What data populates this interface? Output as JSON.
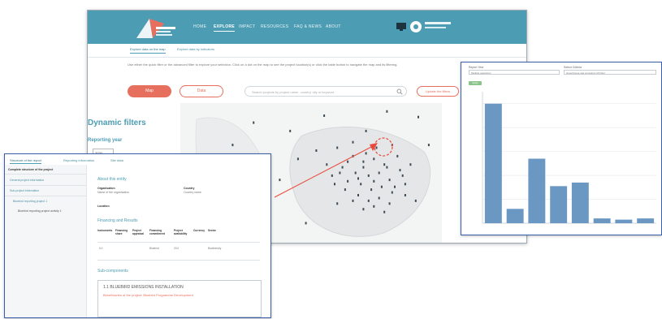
{
  "main_window": {
    "nav": [
      "HOME",
      "EXPLORE",
      "IMPACT",
      "RESOURCES",
      "FAQ & NEWS",
      "ABOUT"
    ],
    "active_nav_index": 1,
    "tabs": [
      "Explore data on the map",
      "Explore data by indicators"
    ],
    "active_tab_index": 0,
    "intro_text": "Use either the quick filter or the advanced filter to explore your selection. Click on a dot on the map to see the project location(s) or click the table button to navigate the map and its filtering.",
    "buttons": {
      "map": "Map",
      "data": "Data",
      "update": "Update the filters"
    },
    "search_placeholder": "Search projects by project name, country, city or keyword",
    "sidebar": {
      "title": "Dynamic filters",
      "reporting_year_label": "Reporting year",
      "reporting_year_value": "2020"
    }
  },
  "chart_window": {
    "filters": [
      {
        "label": "Report Year",
        "value": "Multiple selections"
      },
      {
        "label": "Select Criteria",
        "value": "Greenhouse gas emissions (tCO2e)"
      }
    ],
    "chip_label": "Apply",
    "colors": {
      "bar": "#6b97c3",
      "grid": "#e6e9ec"
    },
    "chart_data": {
      "type": "bar",
      "categories": [
        "",
        "",
        "",
        "",
        "",
        "",
        "",
        ""
      ],
      "values": [
        100,
        12,
        54,
        31,
        34,
        4,
        3,
        4
      ],
      "ylim": [
        0,
        110
      ],
      "ylabel": "",
      "grid": true
    }
  },
  "detail_window": {
    "tabs": [
      "Structure of the report",
      "Reporting information",
      "Site data"
    ],
    "tree": {
      "header": "Complete structure of the project",
      "items": [
        "General project information",
        "Sub-project information",
        "Bluebird reporting project 1",
        "Bluebird reporting project activity 1"
      ]
    },
    "sections": {
      "about": "About this entity",
      "financing": "Financing and Results",
      "sub": "Sub-components"
    },
    "about_fields": [
      {
        "label": "Organisation",
        "value": "Name of the organisation"
      },
      {
        "label": "Country",
        "value": "Country name"
      },
      {
        "label": "Location",
        "value": "Location"
      }
    ],
    "fin_headers": [
      "Instruments",
      "Financing share",
      "Project appraisal",
      "Financing commitment",
      "Project availability",
      "Currency",
      "Sector"
    ],
    "fin_values": [
      "5.0",
      "",
      "",
      "Bluebird",
      "20.0",
      "",
      "Biodiversity"
    ],
    "project": {
      "title": "1.1 BLUEBIRD EMISSIONS INSTALLATION",
      "subtitle": "Beneficiaries of the project: Bluebird Programme Development"
    }
  },
  "map_dots": [
    [
      0.28,
      0.14
    ],
    [
      0.55,
      0.09
    ],
    [
      0.79,
      0.06
    ],
    [
      0.91,
      0.1
    ],
    [
      0.71,
      0.2
    ],
    [
      0.6,
      0.32
    ],
    [
      0.66,
      0.38
    ],
    [
      0.7,
      0.42
    ],
    [
      0.74,
      0.4
    ],
    [
      0.78,
      0.44
    ],
    [
      0.62,
      0.46
    ],
    [
      0.67,
      0.5
    ],
    [
      0.72,
      0.52
    ],
    [
      0.76,
      0.5
    ],
    [
      0.8,
      0.55
    ],
    [
      0.84,
      0.48
    ],
    [
      0.64,
      0.56
    ],
    [
      0.69,
      0.58
    ],
    [
      0.73,
      0.62
    ],
    [
      0.77,
      0.6
    ],
    [
      0.81,
      0.64
    ],
    [
      0.86,
      0.58
    ],
    [
      0.68,
      0.66
    ],
    [
      0.72,
      0.7
    ],
    [
      0.76,
      0.68
    ],
    [
      0.8,
      0.72
    ],
    [
      0.63,
      0.62
    ],
    [
      0.58,
      0.52
    ],
    [
      0.56,
      0.44
    ],
    [
      0.83,
      0.38
    ],
    [
      0.88,
      0.44
    ],
    [
      0.75,
      0.32
    ],
    [
      0.81,
      0.3
    ],
    [
      0.66,
      0.28
    ],
    [
      0.7,
      0.76
    ],
    [
      0.78,
      0.78
    ],
    [
      0.6,
      0.72
    ],
    [
      0.52,
      0.34
    ],
    [
      0.45,
      0.4
    ],
    [
      0.38,
      0.55
    ],
    [
      0.3,
      0.62
    ],
    [
      0.25,
      0.78
    ],
    [
      0.48,
      0.86
    ],
    [
      0.9,
      0.7
    ],
    [
      0.95,
      0.3
    ],
    [
      0.2,
      0.3
    ],
    [
      0.42,
      0.2
    ],
    [
      0.74,
      0.56
    ],
    [
      0.7,
      0.46
    ],
    [
      0.64,
      0.42
    ],
    [
      0.82,
      0.6
    ],
    [
      0.66,
      0.7
    ],
    [
      0.74,
      0.74
    ],
    [
      0.86,
      0.66
    ],
    [
      0.59,
      0.58
    ],
    [
      0.79,
      0.46
    ],
    [
      0.71,
      0.36
    ],
    [
      0.85,
      0.52
    ],
    [
      0.61,
      0.5
    ],
    [
      0.68,
      0.54
    ]
  ]
}
